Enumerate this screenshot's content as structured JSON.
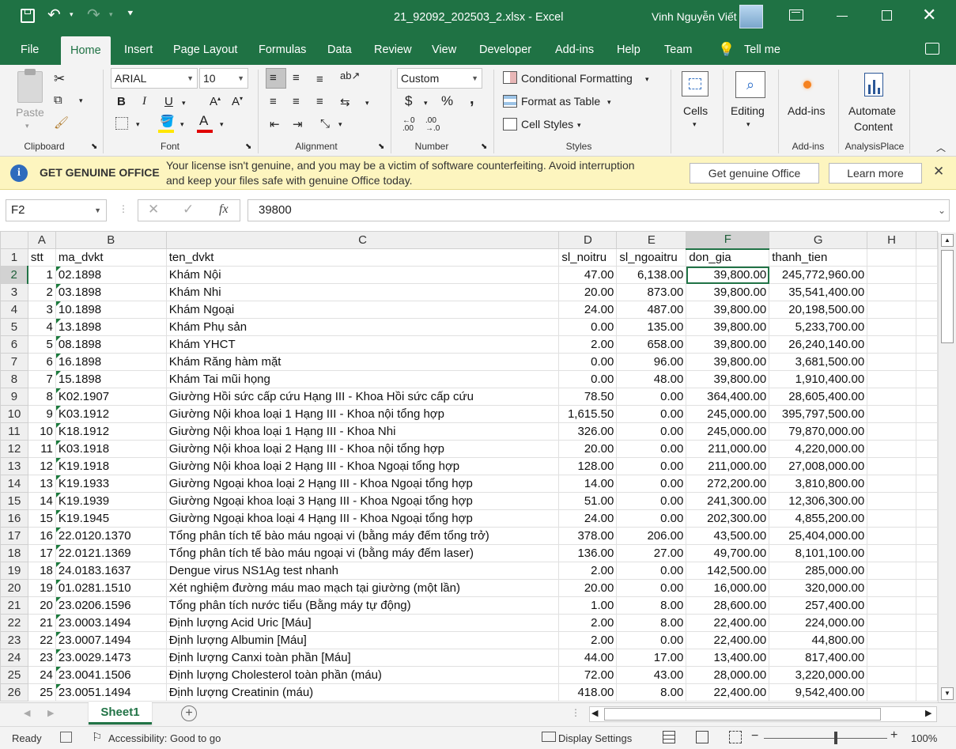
{
  "window": {
    "title": "21_92092_202503_2.xlsx  -  Excel",
    "user": "Vinh Nguyễn Viết"
  },
  "tabs": [
    "File",
    "Home",
    "Insert",
    "Page Layout",
    "Formulas",
    "Data",
    "Review",
    "View",
    "Developer",
    "Add-ins",
    "Help",
    "Team",
    "Tell me"
  ],
  "ribbon": {
    "clipboard": {
      "paste": "Paste",
      "label": "Clipboard"
    },
    "font": {
      "name": "ARIAL",
      "size": "10",
      "label": "Font"
    },
    "alignment": {
      "label": "Alignment"
    },
    "number": {
      "format": "Custom",
      "currency": "$",
      "percent": "%",
      "comma": ",",
      "label": "Number"
    },
    "styles": {
      "conditional": "Conditional Formatting",
      "table": "Format as Table",
      "cell": "Cell Styles",
      "label": "Styles"
    },
    "cells": {
      "label": "Cells"
    },
    "editing": {
      "label": "Editing"
    },
    "addins": {
      "button": "Add-ins",
      "label": "Add-ins"
    },
    "automate": {
      "line1": "Automate",
      "line2": "Content",
      "label": "AnalysisPlace"
    }
  },
  "message": {
    "title": "GET GENUINE OFFICE",
    "line1": "Your license isn't genuine, and you may be a victim of software counterfeiting. Avoid interruption",
    "line2": "and keep your files safe with genuine Office today.",
    "btn1": "Get genuine Office",
    "btn2": "Learn more"
  },
  "formula": {
    "namebox": "F2",
    "fx": "fx",
    "value": "39800"
  },
  "columns": [
    "A",
    "B",
    "C",
    "D",
    "E",
    "F",
    "G",
    "H"
  ],
  "header_row": [
    "stt",
    "ma_dvkt",
    "ten_dvkt",
    "sl_noitru",
    "sl_ngoaitru",
    "don_gia",
    "thanh_tien"
  ],
  "rows": [
    [
      "1",
      "02.1898",
      "Khám Nội",
      "47.00",
      "6,138.00",
      "39,800.00",
      "245,772,960.00"
    ],
    [
      "2",
      "03.1898",
      "Khám Nhi",
      "20.00",
      "873.00",
      "39,800.00",
      "35,541,400.00"
    ],
    [
      "3",
      "10.1898",
      "Khám Ngoại",
      "24.00",
      "487.00",
      "39,800.00",
      "20,198,500.00"
    ],
    [
      "4",
      "13.1898",
      "Khám Phụ sản",
      "0.00",
      "135.00",
      "39,800.00",
      "5,233,700.00"
    ],
    [
      "5",
      "08.1898",
      "Khám YHCT",
      "2.00",
      "658.00",
      "39,800.00",
      "26,240,140.00"
    ],
    [
      "6",
      "16.1898",
      "Khám Răng hàm mặt",
      "0.00",
      "96.00",
      "39,800.00",
      "3,681,500.00"
    ],
    [
      "7",
      "15.1898",
      "Khám Tai mũi họng",
      "0.00",
      "48.00",
      "39,800.00",
      "1,910,400.00"
    ],
    [
      "8",
      "K02.1907",
      "Giường Hồi sức cấp cứu Hạng III - Khoa Hồi sức cấp cứu",
      "78.50",
      "0.00",
      "364,400.00",
      "28,605,400.00"
    ],
    [
      "9",
      "K03.1912",
      "Giường Nội khoa loại 1 Hạng III - Khoa nội tổng hợp",
      "1,615.50",
      "0.00",
      "245,000.00",
      "395,797,500.00"
    ],
    [
      "10",
      "K18.1912",
      "Giường Nội khoa loại 1 Hạng III - Khoa Nhi",
      "326.00",
      "0.00",
      "245,000.00",
      "79,870,000.00"
    ],
    [
      "11",
      "K03.1918",
      "Giường Nội khoa loại 2 Hạng III - Khoa nội tổng hợp",
      "20.00",
      "0.00",
      "211,000.00",
      "4,220,000.00"
    ],
    [
      "12",
      "K19.1918",
      "Giường Nội khoa loại 2 Hạng III - Khoa Ngoại tổng hợp",
      "128.00",
      "0.00",
      "211,000.00",
      "27,008,000.00"
    ],
    [
      "13",
      "K19.1933",
      "Giường Ngoại khoa loại 2 Hạng III - Khoa Ngoại tổng hợp",
      "14.00",
      "0.00",
      "272,200.00",
      "3,810,800.00"
    ],
    [
      "14",
      "K19.1939",
      "Giường Ngoại khoa loại 3 Hạng III - Khoa Ngoại tổng hợp",
      "51.00",
      "0.00",
      "241,300.00",
      "12,306,300.00"
    ],
    [
      "15",
      "K19.1945",
      "Giường Ngoại khoa loại 4 Hạng III - Khoa Ngoại tổng hợp",
      "24.00",
      "0.00",
      "202,300.00",
      "4,855,200.00"
    ],
    [
      "16",
      "22.0120.1370",
      "Tổng phân tích tế bào máu ngoại vi (bằng máy đếm tổng trở)",
      "378.00",
      "206.00",
      "43,500.00",
      "25,404,000.00"
    ],
    [
      "17",
      "22.0121.1369",
      "Tổng phân tích tế bào máu ngoại vi (bằng máy đếm laser)",
      "136.00",
      "27.00",
      "49,700.00",
      "8,101,100.00"
    ],
    [
      "18",
      "24.0183.1637",
      "Dengue virus NS1Ag test nhanh",
      "2.00",
      "0.00",
      "142,500.00",
      "285,000.00"
    ],
    [
      "19",
      "01.0281.1510",
      "Xét nghiệm đường máu mao mạch tại giường (một lần)",
      "20.00",
      "0.00",
      "16,000.00",
      "320,000.00"
    ],
    [
      "20",
      "23.0206.1596",
      "Tổng phân tích nước tiểu (Bằng máy tự động)",
      "1.00",
      "8.00",
      "28,600.00",
      "257,400.00"
    ],
    [
      "21",
      "23.0003.1494",
      "Định lượng Acid Uric [Máu]",
      "2.00",
      "8.00",
      "22,400.00",
      "224,000.00"
    ],
    [
      "22",
      "23.0007.1494",
      "Định lượng Albumin [Máu]",
      "2.00",
      "0.00",
      "22,400.00",
      "44,800.00"
    ],
    [
      "23",
      "23.0029.1473",
      "Định lượng Canxi toàn phần [Máu]",
      "44.00",
      "17.00",
      "13,400.00",
      "817,400.00"
    ],
    [
      "24",
      "23.0041.1506",
      "Định lượng Cholesterol toàn phần (máu)",
      "72.00",
      "43.00",
      "28,000.00",
      "3,220,000.00"
    ],
    [
      "25",
      "23.0051.1494",
      "Định lượng Creatinin (máu)",
      "418.00",
      "8.00",
      "22,400.00",
      "9,542,400.00"
    ]
  ],
  "sheet": {
    "name": "Sheet1"
  },
  "status": {
    "ready": "Ready",
    "accessibility": "Accessibility: Good to go",
    "display": "Display Settings",
    "zoom": "100%"
  }
}
